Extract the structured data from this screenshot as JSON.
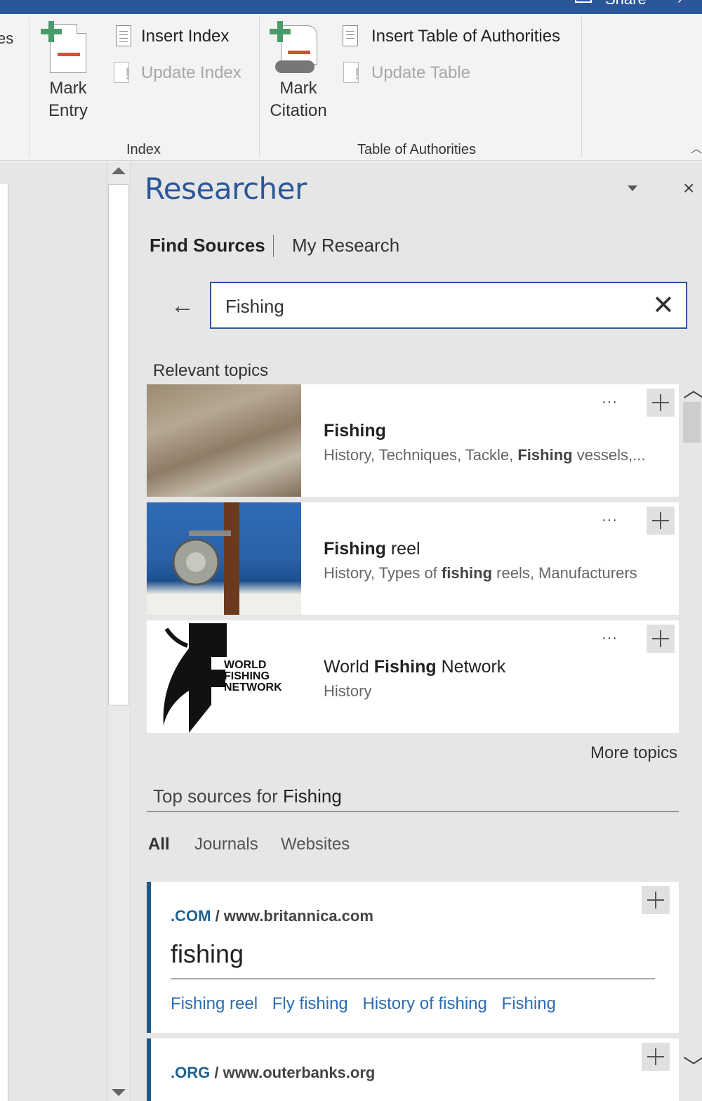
{
  "ribbon": {
    "cut_label": "es",
    "share_label": "Share",
    "mark_entry": {
      "line1": "Mark",
      "line2": "Entry"
    },
    "insert_index": "Insert Index",
    "update_index": "Update Index",
    "index_group": "Index",
    "mark_citation": {
      "line1": "Mark",
      "line2": "Citation"
    },
    "insert_toa": "Insert Table of Authorities",
    "update_table": "Update Table",
    "toa_group": "Table of Authorities"
  },
  "pane": {
    "title": "Researcher",
    "tabs": [
      {
        "label": "Find Sources",
        "active": true
      },
      {
        "label": "My Research",
        "active": false
      }
    ],
    "search": {
      "value": "Fishing"
    },
    "relevant_topics_label": "Relevant topics",
    "topics": [
      {
        "pre": "",
        "bold": "Fishing",
        "post": "",
        "desc_pre": "History, Techniques, Tackle, ",
        "desc_bold": "Fishing",
        "desc_post": " vessels,...",
        "more": "···"
      },
      {
        "pre": "",
        "bold": "Fishing",
        "post": " reel",
        "desc_pre": "History, Types of ",
        "desc_bold": "fishing",
        "desc_post": " reels, Manufacturers",
        "more": "···"
      },
      {
        "pre": "World ",
        "bold": "Fishing",
        "post": " Network",
        "desc_pre": "History",
        "desc_bold": "",
        "desc_post": "",
        "more": "···",
        "logo": [
          "WORLD",
          "FISHING",
          "NETWORK"
        ]
      }
    ],
    "more_topics": "More topics",
    "top_sources": {
      "pre": "Top sources for ",
      "term": "Fishing"
    },
    "filters": [
      {
        "label": "All",
        "active": true
      },
      {
        "label": "Journals",
        "active": false
      },
      {
        "label": "Websites",
        "active": false
      }
    ],
    "sources": [
      {
        "tld": ".COM",
        "sep": " / ",
        "site": "www.britannica.com",
        "title": "fishing",
        "links": [
          "Fishing reel",
          "Fly fishing",
          "History of fishing",
          "Fishing"
        ]
      },
      {
        "tld": ".ORG",
        "sep": " / ",
        "site": "www.outerbanks.org",
        "title": "",
        "links": []
      }
    ]
  },
  "colors": {
    "accent": "#2b579a",
    "ribbon_bg": "#f3f3f3",
    "pane_bg": "#e6e6e6",
    "link": "#2b6cb0",
    "source_border": "#1f5b8a",
    "ribbon_red": "#d35230",
    "ribbon_green": "#4a9a6b"
  },
  "icons": {
    "mark_entry": "document-plus-icon",
    "mark_citation": "scroll-plus-icon",
    "insert_index": "index-page-icon",
    "update_index": "update-page-icon",
    "insert_toa": "toa-page-icon",
    "update_table": "update-page-icon",
    "back": "back-arrow-icon",
    "clear": "close-icon",
    "add": "plus-icon",
    "more": "ellipsis-icon",
    "pane_close": "close-icon",
    "pane_menu": "chevron-down-icon"
  }
}
